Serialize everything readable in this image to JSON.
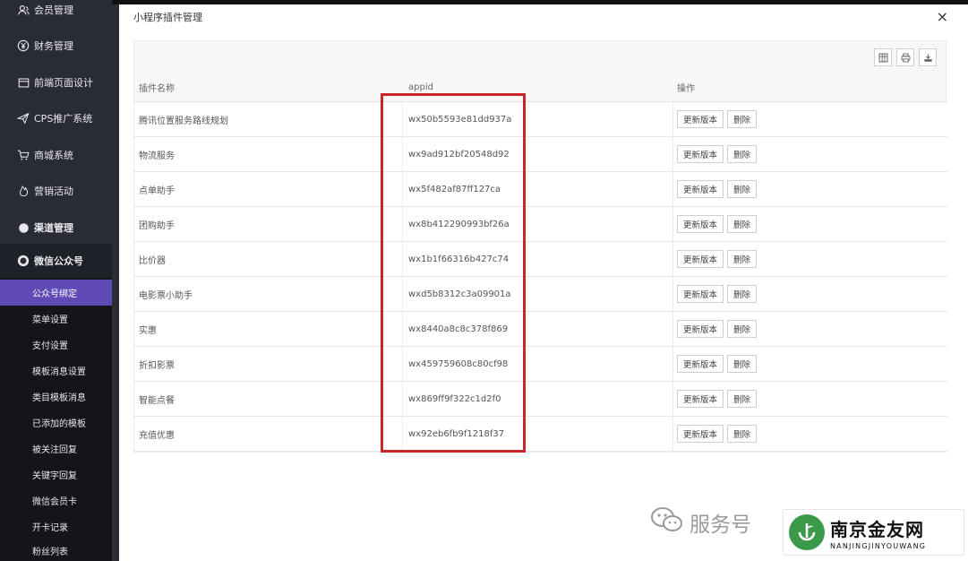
{
  "sidebar": {
    "items": [
      {
        "icon": "user-group-icon",
        "label": "会员管理"
      },
      {
        "icon": "yen-icon",
        "label": "财务管理"
      },
      {
        "icon": "layout-icon",
        "label": "前端页面设计"
      },
      {
        "icon": "send-icon",
        "label": "CPS推广系统"
      },
      {
        "icon": "cart-icon",
        "label": "商城系统"
      },
      {
        "icon": "flame-icon",
        "label": "营销活动"
      },
      {
        "icon": "circle-icon",
        "label": "渠道管理"
      },
      {
        "icon": "wechat-icon",
        "label": "微信公众号"
      }
    ],
    "sub_items": [
      "公众号绑定",
      "菜单设置",
      "支付设置",
      "模板消息设置",
      "类目模板消息",
      "已添加的模板",
      "被关注回复",
      "关键字回复",
      "微信会员卡",
      "开卡记录",
      "粉丝列表"
    ]
  },
  "modal": {
    "title": "小程序插件管理",
    "close": "×"
  },
  "table": {
    "headers": [
      "插件名称",
      "appid",
      "操作"
    ],
    "update_label": "更新版本",
    "delete_label": "删除",
    "rows": [
      {
        "name": "腾讯位置服务路线规划",
        "appid": "wx50b5593e81dd937a"
      },
      {
        "name": "物流服务",
        "appid": "wx9ad912bf20548d92"
      },
      {
        "name": "点单助手",
        "appid": "wx5f482af87ff127ca"
      },
      {
        "name": "团购助手",
        "appid": "wx8b412290993bf26a"
      },
      {
        "name": "比价器",
        "appid": "wx1b1f66316b427c74"
      },
      {
        "name": "电影票小助手",
        "appid": "wxd5b8312c3a09901a"
      },
      {
        "name": "实惠",
        "appid": "wx8440a8c8c378f869"
      },
      {
        "name": "折扣影票",
        "appid": "wx459759608c80cf98"
      },
      {
        "name": "智能点餐",
        "appid": "wx869ff9f322c1d2f0"
      },
      {
        "name": "充值优惠",
        "appid": "wx92eb6fb9f1218f37"
      }
    ]
  },
  "watermark": {
    "service_text": "服务号",
    "brand_cn": "南京金友网",
    "brand_en": "NANJINGJINYOUWANG"
  },
  "colors": {
    "sidebar_bg": "#2a2c35",
    "sub_active": "#5f4ab6",
    "highlight": "#c8262a",
    "logo_green": "#3b9a4a"
  }
}
